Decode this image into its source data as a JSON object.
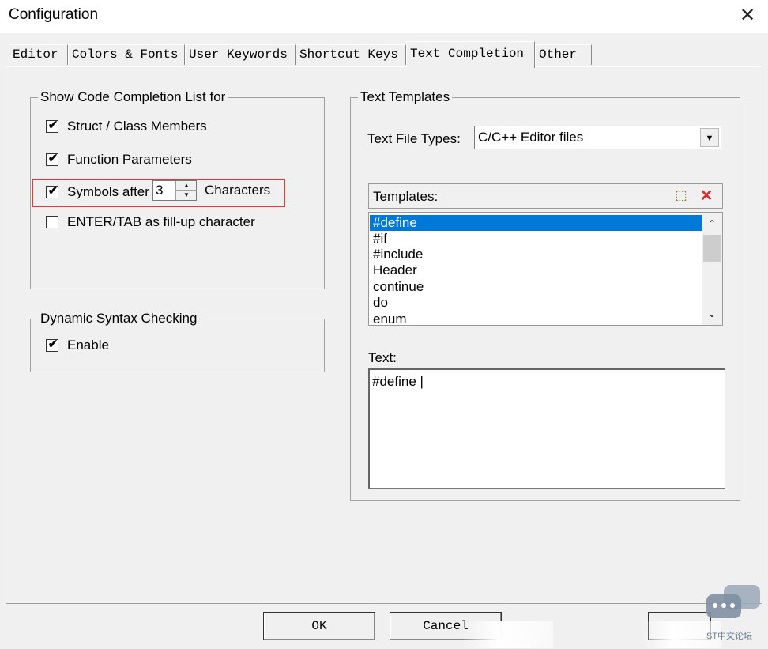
{
  "window": {
    "title": "Configuration",
    "close_glyph": "✕"
  },
  "tabs": [
    {
      "label": "Editor"
    },
    {
      "label": "Colors & Fonts"
    },
    {
      "label": "User Keywords"
    },
    {
      "label": "Shortcut Keys"
    },
    {
      "label": "Text Completion",
      "active": true
    },
    {
      "label": "Other"
    }
  ],
  "completion": {
    "legend": "Show Code Completion List for",
    "struct": {
      "label": "Struct / Class Members",
      "checked": true
    },
    "params": {
      "label": "Function Parameters",
      "checked": true
    },
    "symbols": {
      "label": "Symbols after",
      "checked": true,
      "value": "3",
      "suffix": "Characters"
    },
    "enter_tab": {
      "label": "ENTER/TAB as fill-up character",
      "checked": false
    }
  },
  "syntax": {
    "legend": "Dynamic Syntax Checking",
    "enable": {
      "label": "Enable",
      "checked": true
    }
  },
  "templates": {
    "legend": "Text Templates",
    "file_types_label": "Text File Types:",
    "file_types_value": "C/C++ Editor files",
    "list_label": "Templates:",
    "items": [
      "#define",
      "#if",
      "#include",
      "Header",
      "continue",
      "do",
      "enum"
    ],
    "selected_index": 0,
    "text_label": "Text:",
    "text_value": "#define |"
  },
  "buttons": {
    "ok": "OK",
    "cancel": "Cancel"
  },
  "watermark": {
    "text": "ST中文论坛"
  },
  "icons": {
    "check": "✔",
    "arrow_down": "▼",
    "spin_up": "▲",
    "spin_down": "▼",
    "scroll_up": "⌃",
    "scroll_down": "⌄",
    "new": "⬚",
    "delete": "✕"
  },
  "colors": {
    "selection": "#0078d7",
    "highlight_box": "#e53935",
    "delete_icon": "#d32f2f"
  }
}
